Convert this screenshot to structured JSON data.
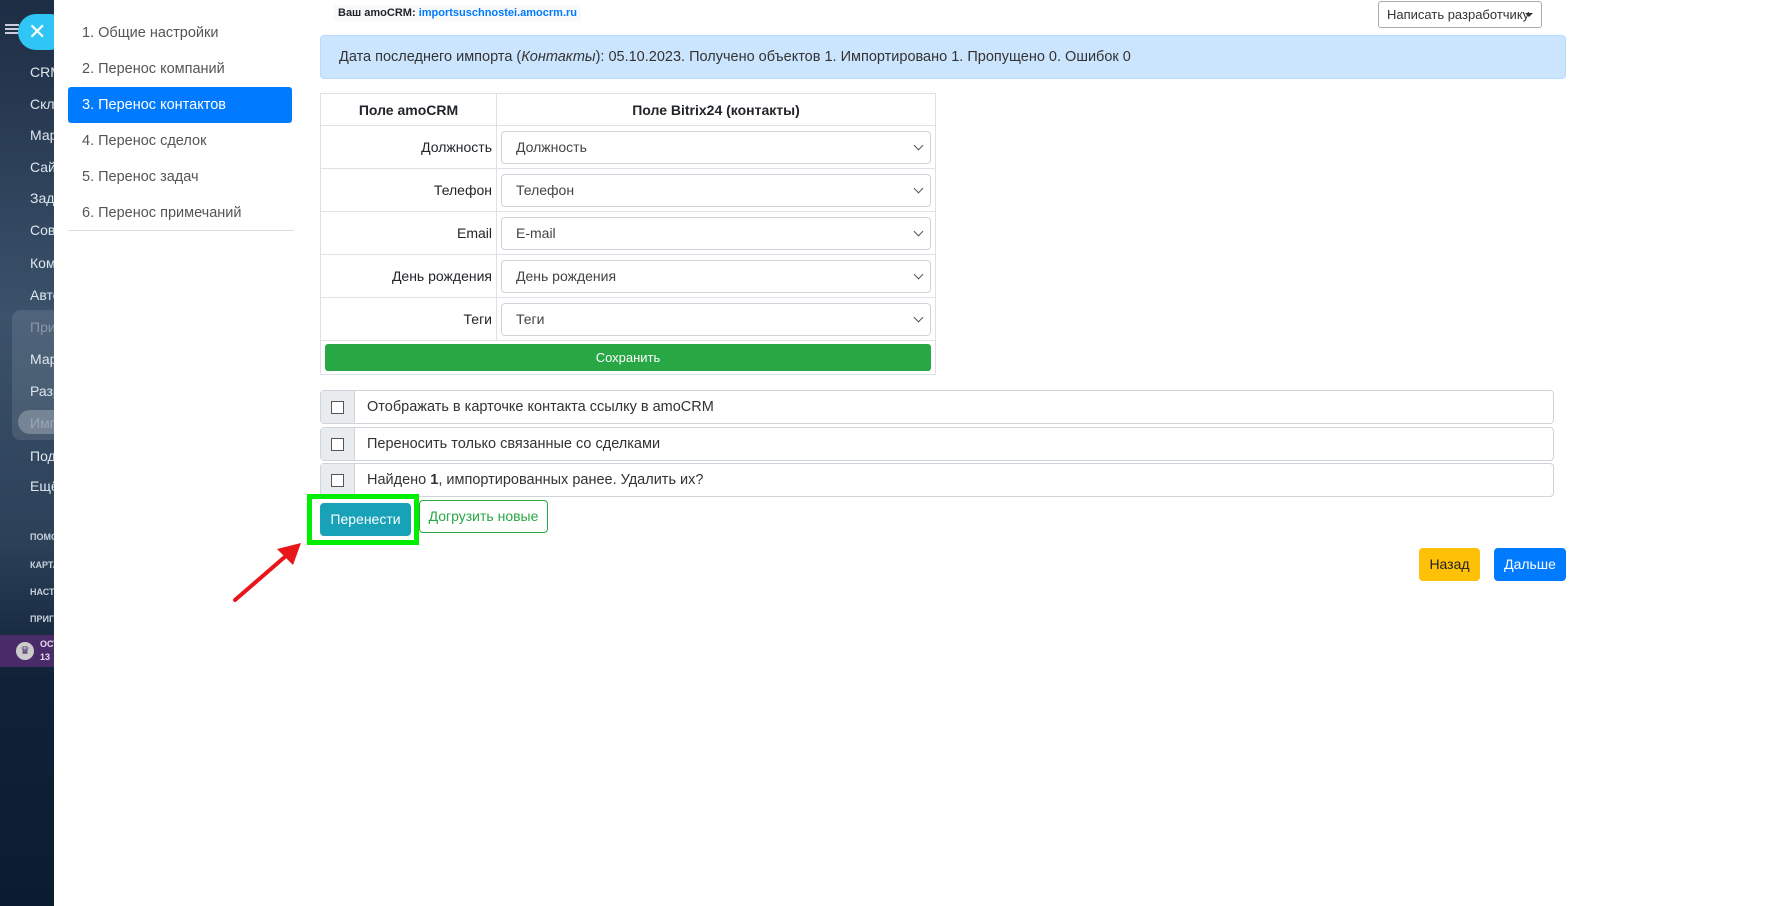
{
  "sidebar": {
    "items": [
      "CRM",
      "Скла",
      "Мар",
      "Сайт",
      "Зада",
      "Совм",
      "Комі",
      "Авто",
      "При",
      "Мар",
      "Разр",
      "Имп",
      "Под",
      "Ещё"
    ],
    "small": [
      "ПОМО",
      "КАРТА",
      "НАСТР",
      "ПРИГЛ"
    ],
    "promo": [
      "ОСТ",
      "13"
    ]
  },
  "nav": [
    "1. Общие настройки",
    "2. Перенос компаний",
    "3. Перенос контактов",
    "4. Перенос сделок",
    "5. Перенос задач",
    "6. Перенос примечаний"
  ],
  "account": {
    "label": "Ваш amoCRM:",
    "domain": "importsuschnostei.amocrm.ru"
  },
  "dev_button": "Написать разработчику",
  "alert": {
    "prefix": "Дата последнего импорта (",
    "entity": "Контакты",
    "suffix": "): 05.10.2023. Получено объектов 1. Импортировано 1. Пропущено 0. Ошибок 0"
  },
  "table": {
    "headers": [
      "Поле amoCRM",
      "Поле Bitrix24 (контакты)"
    ],
    "rows": [
      {
        "field": "Должность",
        "value": "Должность"
      },
      {
        "field": "Телефон",
        "value": "Телефон"
      },
      {
        "field": "Email",
        "value": "E-mail"
      },
      {
        "field": "День рождения",
        "value": "День рождения"
      },
      {
        "field": "Теги",
        "value": "Теги"
      }
    ],
    "save": "Сохранить"
  },
  "options": {
    "o1": "Отображать в карточке контакта ссылку в amoCRM",
    "o2": "Переносить только связанные со сделками",
    "o3_pre": "Найдено ",
    "o3_num": "1",
    "o3_post": ", импортированных ранее. Удалить их?"
  },
  "buttons": {
    "move": "Перенести",
    "load_new": "Догрузить новые",
    "back": "Назад",
    "next": "Дальше"
  }
}
